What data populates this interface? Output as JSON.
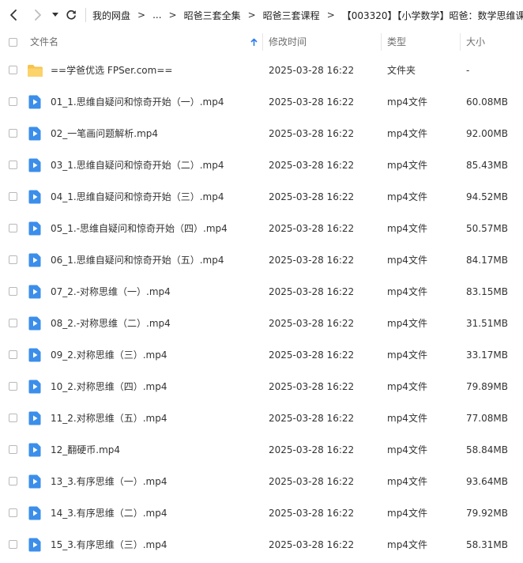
{
  "toolbar": {
    "back_icon": "chevron-left-icon",
    "forward_icon": "chevron-right-icon",
    "history_icon": "caret-down-icon",
    "refresh_icon": "refresh-icon",
    "breadcrumbs": [
      "我的网盘",
      "...",
      "昭爸三套全集",
      "昭爸三套课程",
      "【003320】【小学数学】昭爸：数学思维课"
    ]
  },
  "columns": {
    "name": "文件名",
    "modified": "修改时间",
    "type": "类型",
    "size": "大小",
    "sort_icon": "arrow-up-icon"
  },
  "colors": {
    "folder": "#f7c34a",
    "video": "#3b8eea",
    "sort_arrow": "#2b7de9"
  },
  "files": [
    {
      "icon": "folder-icon",
      "name": "==学爸优选 FPSer.com==",
      "modified": "2025-03-28 16:22",
      "type": "文件夹",
      "size": "-"
    },
    {
      "icon": "video-file-icon",
      "name": "01_1.思维自疑问和惊奇开始（一）.mp4",
      "modified": "2025-03-28 16:22",
      "type": "mp4文件",
      "size": "60.08MB"
    },
    {
      "icon": "video-file-icon",
      "name": "02_一笔画问题解析.mp4",
      "modified": "2025-03-28 16:22",
      "type": "mp4文件",
      "size": "92.00MB"
    },
    {
      "icon": "video-file-icon",
      "name": "03_1.思维自疑问和惊奇开始（二）.mp4",
      "modified": "2025-03-28 16:22",
      "type": "mp4文件",
      "size": "85.43MB"
    },
    {
      "icon": "video-file-icon",
      "name": "04_1.思维自疑问和惊奇开始（三）.mp4",
      "modified": "2025-03-28 16:22",
      "type": "mp4文件",
      "size": "94.52MB"
    },
    {
      "icon": "video-file-icon",
      "name": "05_1.-思维自疑问和惊奇开始（四）.mp4",
      "modified": "2025-03-28 16:22",
      "type": "mp4文件",
      "size": "50.57MB"
    },
    {
      "icon": "video-file-icon",
      "name": "06_1.思维自疑问和惊奇开始（五）.mp4",
      "modified": "2025-03-28 16:22",
      "type": "mp4文件",
      "size": "84.17MB"
    },
    {
      "icon": "video-file-icon",
      "name": "07_2.-对称思维（一）.mp4",
      "modified": "2025-03-28 16:22",
      "type": "mp4文件",
      "size": "83.15MB"
    },
    {
      "icon": "video-file-icon",
      "name": "08_2.-对称思维（二）.mp4",
      "modified": "2025-03-28 16:22",
      "type": "mp4文件",
      "size": "31.51MB"
    },
    {
      "icon": "video-file-icon",
      "name": "09_2.对称思维（三）.mp4",
      "modified": "2025-03-28 16:22",
      "type": "mp4文件",
      "size": "33.17MB"
    },
    {
      "icon": "video-file-icon",
      "name": "10_2.对称思维（四）.mp4",
      "modified": "2025-03-28 16:22",
      "type": "mp4文件",
      "size": "79.89MB"
    },
    {
      "icon": "video-file-icon",
      "name": "11_2.对称思维（五）.mp4",
      "modified": "2025-03-28 16:22",
      "type": "mp4文件",
      "size": "77.08MB"
    },
    {
      "icon": "video-file-icon",
      "name": "12_翻硬币.mp4",
      "modified": "2025-03-28 16:22",
      "type": "mp4文件",
      "size": "58.84MB"
    },
    {
      "icon": "video-file-icon",
      "name": "13_3.有序思维（一）.mp4",
      "modified": "2025-03-28 16:22",
      "type": "mp4文件",
      "size": "93.64MB"
    },
    {
      "icon": "video-file-icon",
      "name": "14_3.有序思维（二）.mp4",
      "modified": "2025-03-28 16:22",
      "type": "mp4文件",
      "size": "79.92MB"
    },
    {
      "icon": "video-file-icon",
      "name": "15_3.有序思维（三）.mp4",
      "modified": "2025-03-28 16:22",
      "type": "mp4文件",
      "size": "58.31MB"
    }
  ]
}
